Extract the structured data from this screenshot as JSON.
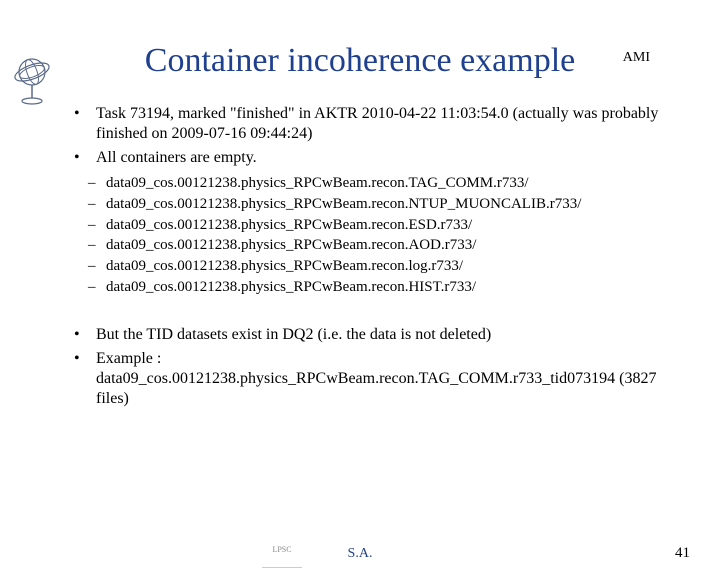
{
  "header": {
    "label": "AMI"
  },
  "title": "Container incoherence example",
  "bullets_top": [
    "Task 73194, marked \"finished\" in AKTR 2010-04-22 11:03:54.0 (actually was probably finished on 2009-07-16 09:44:24)",
    "All containers are empty."
  ],
  "sub_bullets": [
    "data09_cos.00121238.physics_RPCwBeam.recon.TAG_COMM.r733/",
    "data09_cos.00121238.physics_RPCwBeam.recon.NTUP_MUONCALIB.r733/",
    "data09_cos.00121238.physics_RPCwBeam.recon.ESD.r733/",
    "data09_cos.00121238.physics_RPCwBeam.recon.AOD.r733/",
    "data09_cos.00121238.physics_RPCwBeam.recon.log.r733/",
    "data09_cos.00121238.physics_RPCwBeam.recon.HIST.r733/"
  ],
  "bullets_bottom": [
    "But the TID datasets exist in DQ2 (i.e. the data is not deleted)",
    "Example : data09_cos.00121238.physics_RPCwBeam.recon.TAG_COMM.r733_tid073194 (3827 files)"
  ],
  "footer": {
    "center": "S.A.",
    "page": "41",
    "logo_text": "LPSC"
  }
}
